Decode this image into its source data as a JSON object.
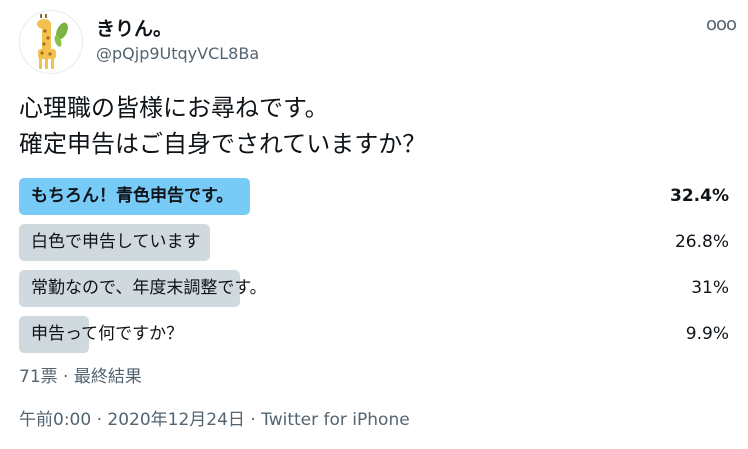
{
  "user": {
    "display_name": "きりん。",
    "handle": "@pQjp9UtqyVCL8Ba",
    "avatar_icon": "giraffe-icon"
  },
  "more_icon": "more-options-icon",
  "more_label": "ooo",
  "tweet": {
    "lines": [
      "心理職の皆様にお尋ねです。",
      "確定申告はご自身でされていますか？"
    ]
  },
  "poll": {
    "options": [
      {
        "label": "もちろん！青色申告です。",
        "percent": "32.4%",
        "value": 32.4,
        "winner": true
      },
      {
        "label": "白色で申告しています",
        "percent": "26.8%",
        "value": 26.8,
        "winner": false
      },
      {
        "label": "常勤なので、年度末調整です。",
        "percent": "31%",
        "value": 31,
        "winner": false
      },
      {
        "label": "申告って何ですか？",
        "percent": "9.9%",
        "value": 9.9,
        "winner": false
      }
    ],
    "summary": "71票 · 最終結果"
  },
  "footer": {
    "timestamp": "午前0:00 · 2020年12月24日",
    "separator": " · ",
    "source": "Twitter for iPhone"
  },
  "colors": {
    "winner_bar": "#79cbf7",
    "other_bar": "#cfd9de",
    "secondary_text": "#536471"
  }
}
